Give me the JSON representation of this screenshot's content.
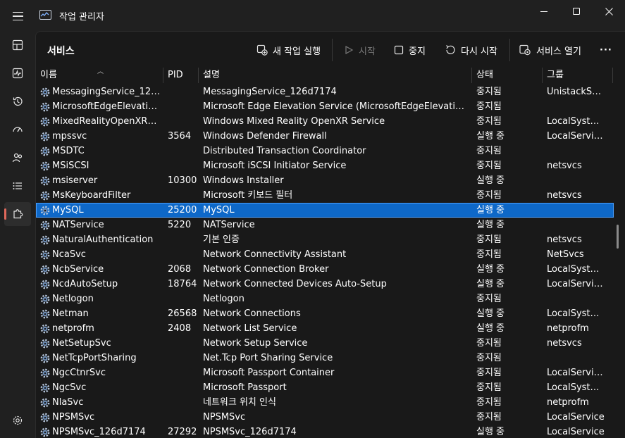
{
  "app": {
    "title": "작업 관리자"
  },
  "window_controls": {
    "minimize": "—",
    "maximize": "☐",
    "close": "✕"
  },
  "page": {
    "title": "서비스"
  },
  "toolbar": {
    "new_task": "새 작업 실행",
    "start": "시작",
    "stop": "중지",
    "restart": "다시 시작",
    "open_services": "서비스 열기",
    "more": "···"
  },
  "rail": {
    "items": [
      "hamburger-menu",
      "processes-icon",
      "performance-icon",
      "app-history-icon",
      "startup-apps-icon",
      "users-icon",
      "details-icon",
      "services-icon",
      "settings-icon"
    ],
    "accent": "#e0685b"
  },
  "table": {
    "columns": {
      "name": "이름",
      "pid": "PID",
      "description": "설명",
      "status": "상태",
      "group": "그룹"
    },
    "selected_color": "#0e68c8",
    "rows": [
      {
        "name": "MessagingService_126d...",
        "pid": "",
        "description": "MessagingService_126d7174",
        "status": "중지됨",
        "group": "UnistackSvcG..."
      },
      {
        "name": "MicrosoftEdgeElevationS...",
        "pid": "",
        "description": "Microsoft Edge Elevation Service (MicrosoftEdgeElevationSer...",
        "status": "중지됨",
        "group": ""
      },
      {
        "name": "MixedRealityOpenXRSvc",
        "pid": "",
        "description": "Windows Mixed Reality OpenXR Service",
        "status": "중지됨",
        "group": "LocalSystem..."
      },
      {
        "name": "mpssvc",
        "pid": "3564",
        "description": "Windows Defender Firewall",
        "status": "실행 중",
        "group": "LocalService..."
      },
      {
        "name": "MSDTC",
        "pid": "",
        "description": "Distributed Transaction Coordinator",
        "status": "중지됨",
        "group": ""
      },
      {
        "name": "MSiSCSI",
        "pid": "",
        "description": "Microsoft iSCSI Initiator Service",
        "status": "중지됨",
        "group": "netsvcs"
      },
      {
        "name": "msiserver",
        "pid": "10300",
        "description": "Windows Installer",
        "status": "실행 중",
        "group": ""
      },
      {
        "name": "MsKeyboardFilter",
        "pid": "",
        "description": "Microsoft 키보드 필터",
        "status": "중지됨",
        "group": "netsvcs"
      },
      {
        "name": "MySQL",
        "pid": "25200",
        "description": "MySQL",
        "status": "실행 중",
        "group": "",
        "selected": true
      },
      {
        "name": "NATService",
        "pid": "5220",
        "description": "NATService",
        "status": "실행 중",
        "group": ""
      },
      {
        "name": "NaturalAuthentication",
        "pid": "",
        "description": "기본 인증",
        "status": "중지됨",
        "group": "netsvcs"
      },
      {
        "name": "NcaSvc",
        "pid": "",
        "description": "Network Connectivity Assistant",
        "status": "중지됨",
        "group": "NetSvcs"
      },
      {
        "name": "NcbService",
        "pid": "2068",
        "description": "Network Connection Broker",
        "status": "실행 중",
        "group": "LocalSystem..."
      },
      {
        "name": "NcdAutoSetup",
        "pid": "18764",
        "description": "Network Connected Devices Auto-Setup",
        "status": "실행 중",
        "group": "LocalService..."
      },
      {
        "name": "Netlogon",
        "pid": "",
        "description": "Netlogon",
        "status": "중지됨",
        "group": ""
      },
      {
        "name": "Netman",
        "pid": "26568",
        "description": "Network Connections",
        "status": "실행 중",
        "group": "LocalSystem..."
      },
      {
        "name": "netprofm",
        "pid": "2408",
        "description": "Network List Service",
        "status": "실행 중",
        "group": "netprofm"
      },
      {
        "name": "NetSetupSvc",
        "pid": "",
        "description": "Network Setup Service",
        "status": "중지됨",
        "group": "netsvcs"
      },
      {
        "name": "NetTcpPortSharing",
        "pid": "",
        "description": "Net.Tcp Port Sharing Service",
        "status": "중지됨",
        "group": ""
      },
      {
        "name": "NgcCtnrSvc",
        "pid": "",
        "description": "Microsoft Passport Container",
        "status": "중지됨",
        "group": "LocalService..."
      },
      {
        "name": "NgcSvc",
        "pid": "",
        "description": "Microsoft Passport",
        "status": "중지됨",
        "group": "LocalSystem..."
      },
      {
        "name": "NlaSvc",
        "pid": "",
        "description": "네트워크 위치 인식",
        "status": "중지됨",
        "group": "netprofm"
      },
      {
        "name": "NPSMSvc",
        "pid": "",
        "description": "NPSMSvc",
        "status": "중지됨",
        "group": "LocalService"
      },
      {
        "name": "NPSMSvc_126d7174",
        "pid": "27292",
        "description": "NPSMSvc_126d7174",
        "status": "실행 중",
        "group": "LocalService"
      }
    ]
  }
}
